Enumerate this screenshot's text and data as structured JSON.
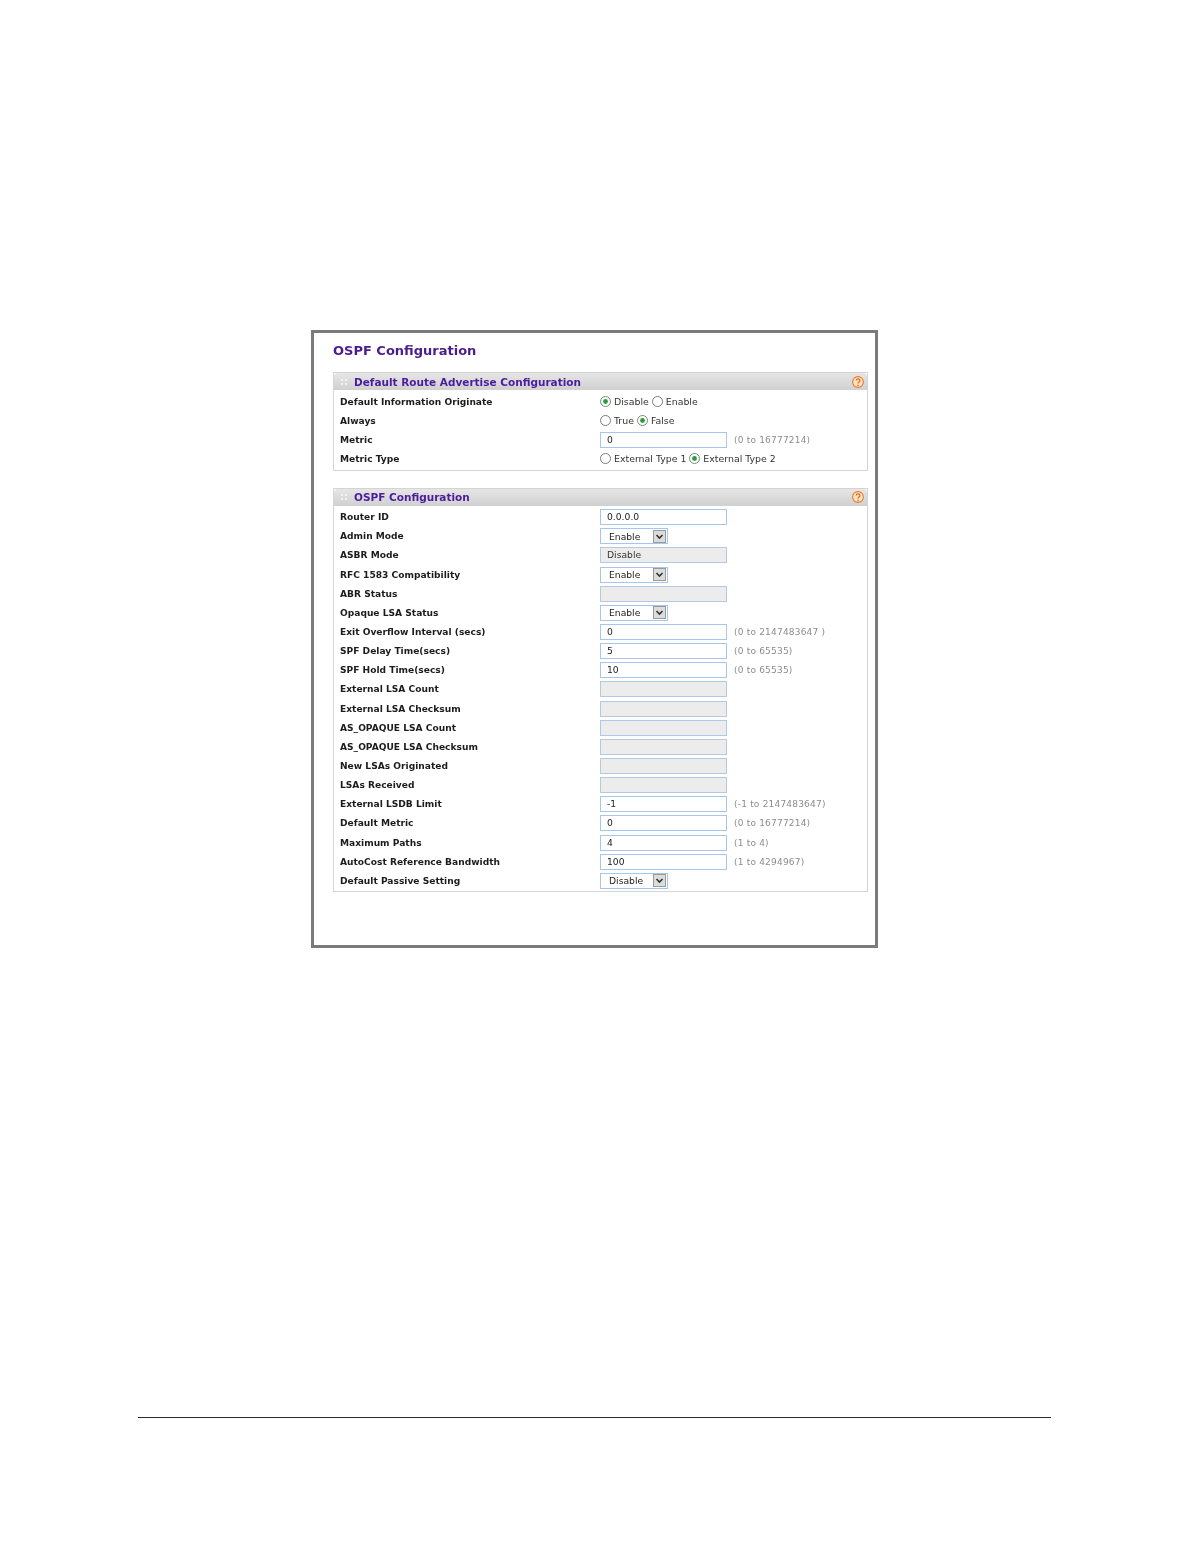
{
  "title": "OSPF Configuration",
  "sections": [
    {
      "title": "Default Route Advertise Configuration",
      "rows": [
        {
          "label": "Default Information Originate",
          "kind": "radio",
          "options": [
            {
              "label": "Disable",
              "selected": true
            },
            {
              "label": "Enable",
              "selected": false
            }
          ]
        },
        {
          "label": "Always",
          "kind": "radio",
          "options": [
            {
              "label": "True",
              "selected": false
            },
            {
              "label": "False",
              "selected": true
            }
          ]
        },
        {
          "label": "Metric",
          "kind": "text",
          "value": "0",
          "range": "(0 to 16777214)"
        },
        {
          "label": "Metric Type",
          "kind": "radio",
          "options": [
            {
              "label": "External Type 1",
              "selected": false
            },
            {
              "label": "External Type 2",
              "selected": true
            }
          ]
        }
      ]
    },
    {
      "title": "OSPF Configuration",
      "rows": [
        {
          "label": "Router ID",
          "kind": "text",
          "value": "0.0.0.0"
        },
        {
          "label": "Admin Mode",
          "kind": "select",
          "value": "Enable"
        },
        {
          "label": "ASBR Mode",
          "kind": "readonly",
          "value": "Disable"
        },
        {
          "label": "RFC 1583 Compatibility",
          "kind": "select",
          "value": "Enable"
        },
        {
          "label": "ABR Status",
          "kind": "readonly"
        },
        {
          "label": "Opaque LSA Status",
          "kind": "select",
          "value": "Enable"
        },
        {
          "label": "Exit Overflow Interval (secs)",
          "kind": "text",
          "value": "0",
          "range": "(0 to 2147483647 )"
        },
        {
          "label": "SPF Delay Time(secs)",
          "kind": "text",
          "value": "5",
          "range": "(0 to 65535)"
        },
        {
          "label": "SPF Hold Time(secs)",
          "kind": "text",
          "value": "10",
          "range": "(0 to 65535)"
        },
        {
          "label": "External LSA Count",
          "kind": "readonly"
        },
        {
          "label": "External LSA Checksum",
          "kind": "readonly"
        },
        {
          "label": "AS_OPAQUE LSA Count",
          "kind": "readonly"
        },
        {
          "label": "AS_OPAQUE LSA Checksum",
          "kind": "readonly"
        },
        {
          "label": "New LSAs Originated",
          "kind": "readonly"
        },
        {
          "label": "LSAs Received",
          "kind": "readonly"
        },
        {
          "label": "External LSDB Limit",
          "kind": "text",
          "value": "-1",
          "range": "(-1 to 2147483647)"
        },
        {
          "label": "Default Metric",
          "kind": "text",
          "value": "0",
          "range": "(0 to 16777214)"
        },
        {
          "label": "Maximum Paths",
          "kind": "text",
          "value": "4",
          "range": "(1 to 4)"
        },
        {
          "label": "AutoCost Reference Bandwidth",
          "kind": "text",
          "value": "100",
          "range": "(1 to 4294967)"
        },
        {
          "label": "Default Passive Setting",
          "kind": "select",
          "value": "Disable"
        }
      ]
    }
  ]
}
